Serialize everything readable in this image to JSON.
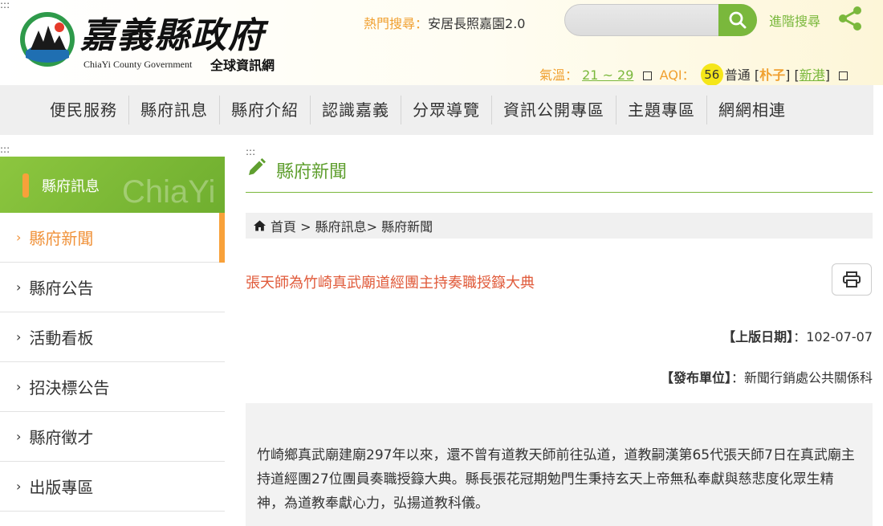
{
  "header": {
    "logo_title": "嘉義縣政府",
    "logo_subtitle_en": "ChiaYi County Government",
    "logo_subtitle_zh": "全球資訊網",
    "hot_search_label": "熱門搜尋：",
    "hot_search_value": "安居長照嘉園2.0",
    "search_placeholder": "",
    "advanced_search": "進階搜尋",
    "weather_label": "氣溫：",
    "temperature": "21 ~ 29",
    "aqi_label": "AQI：",
    "aqi_value": "56",
    "aqi_status": "普通",
    "station_1": "朴子",
    "station_2": "新港"
  },
  "nav": {
    "items": [
      "便民服務",
      "縣府訊息",
      "縣府介紹",
      "認識嘉義",
      "分眾導覽",
      "資訊公開專區",
      "主題專區",
      "網網相連"
    ]
  },
  "sidebar": {
    "heading": "縣府訊息",
    "watermark": "ChiaYi",
    "items": [
      {
        "label": "縣府新聞"
      },
      {
        "label": "縣府公告"
      },
      {
        "label": "活動看板"
      },
      {
        "label": "招決標公告"
      },
      {
        "label": "縣府徵才"
      },
      {
        "label": "出版專區"
      }
    ]
  },
  "main": {
    "page_title": "縣府新聞",
    "breadcrumb": "首頁 > 縣府訊息> 縣府新聞",
    "news_title": "張天師為竹崎真武廟道經團主持奏職授籙大典",
    "date_label": "【上版日期】",
    "date_value": "：102-07-07",
    "unit_label": "【發布單位】",
    "unit_value": "：新聞行銷處公共關係科",
    "body": "竹崎鄉真武廟建廟297年以來，還不曾有道教天師前往弘道，道教嗣漢第65代張天師7日在真武廟主持道經團27位團員奏職授籙大典。縣長張花冠期勉門生秉持玄天上帝無私奉獻與慈悲度化眾生精神，為道教奉獻心力，弘揚道教科儀。"
  },
  "colors": {
    "brand_green": "#7ab83c",
    "accent_orange": "#f8a13a",
    "title_red": "#e05a3a",
    "aqi_yellow": "#f5e619"
  }
}
